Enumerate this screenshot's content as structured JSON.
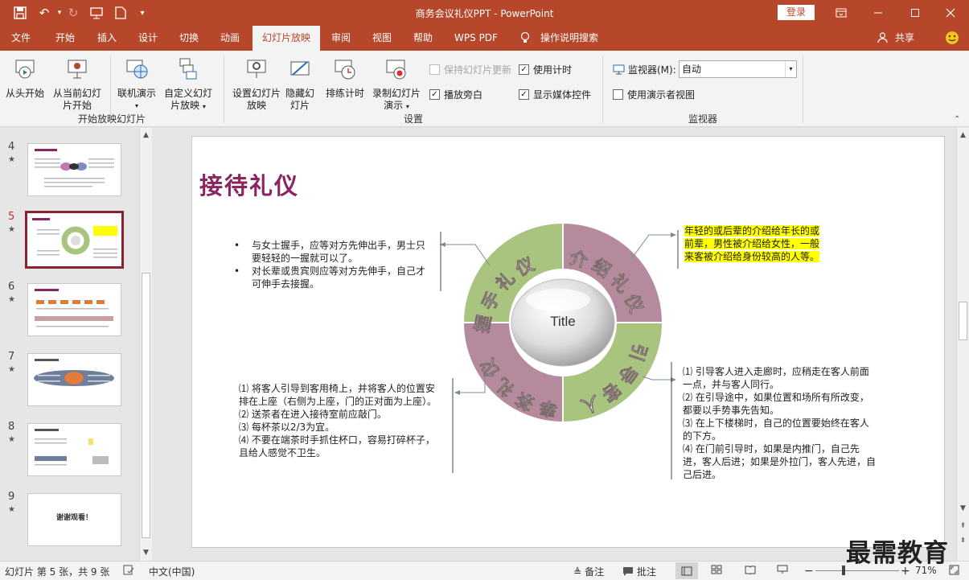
{
  "window": {
    "title": "商务会议礼仪PPT  -  PowerPoint",
    "login_label": "登录",
    "share_label": "共享"
  },
  "tabs": [
    "文件",
    "开始",
    "插入",
    "设计",
    "切换",
    "动画",
    "幻灯片放映",
    "审阅",
    "视图",
    "帮助",
    "WPS PDF",
    "操作说明搜索"
  ],
  "active_tab": "幻灯片放映",
  "ribbon": {
    "start_group": {
      "label": "开始放映幻灯片",
      "buttons": [
        "从头开始",
        "从当前幻灯片开始",
        "联机演示",
        "自定义幻灯片放映"
      ]
    },
    "setup_group": {
      "label": "设置",
      "buttons": [
        "设置幻灯片放映",
        "隐藏幻灯片",
        "排练计时",
        "录制幻灯片演示"
      ],
      "checks": [
        {
          "label": "保持幻灯片更新",
          "checked": false,
          "disabled": true
        },
        {
          "label": "使用计时",
          "checked": true,
          "disabled": false
        },
        {
          "label": "播放旁白",
          "checked": true,
          "disabled": false
        },
        {
          "label": "显示媒体控件",
          "checked": true,
          "disabled": false
        }
      ]
    },
    "monitor_group": {
      "label": "监视器",
      "monitor_label": "监视器(M):",
      "monitor_value": "自动",
      "presenter_view": {
        "label": "使用演示者视图",
        "checked": false
      }
    }
  },
  "thumbnails": [
    {
      "num": "4",
      "selected": false,
      "text": ""
    },
    {
      "num": "5",
      "selected": true,
      "text": ""
    },
    {
      "num": "6",
      "selected": false,
      "text": ""
    },
    {
      "num": "7",
      "selected": false,
      "text": ""
    },
    {
      "num": "8",
      "selected": false,
      "text": ""
    },
    {
      "num": "9",
      "selected": false,
      "text": "谢谢观看！"
    }
  ],
  "slide": {
    "title": "接待礼仪",
    "center_label": "Title",
    "segments": [
      "握手礼仪",
      "介绍礼仪",
      "引导客人",
      "奉茶礼仪"
    ],
    "handshake_bullets": [
      "与女士握手，应等对方先伸出手，男士只要轻轻的一握就可以了。",
      "对长辈或贵宾则应等对方先伸手，自己才可伸手去接握。"
    ],
    "intro_text": "年轻的或后辈的介绍给年长的或前辈，男性被介绍给女性，一般来客被介绍给身份较高的人等。",
    "guide_lines": [
      "⑴ 引导客人进入走廊时，应稍走在客人前面一点，并与客人同行。",
      "⑵ 在引导途中，如果位置和场所有所改变，都要以手势事先告知。",
      "⑶ 在上下楼梯时，自己的位置要始终在客人的下方。",
      "⑷ 在门前引导时，如果是内推门，自己先进，客人后进；如果是外拉门，客人先进，自己后进。"
    ],
    "tea_lines": [
      "⑴ 将客人引导到客用椅上，并将客人的位置安排在上座（右侧为上座，门的正对面为上座）。",
      "⑵ 送茶者在进入接待室前应敲门。",
      "⑶ 每杯茶以2/3为宜。",
      "⑷ 不要在端茶时手抓住杯口，容易打碎杯子，且给人感觉不卫生。"
    ]
  },
  "status": {
    "slide_info": "幻灯片 第 5 张，共 9 张",
    "language": "中文(中国)",
    "notes_label": "备注",
    "comments_label": "批注",
    "zoom": "71%",
    "zoom_fraction": 0.71
  },
  "watermark": "最需教育",
  "colors": {
    "accent": "#b7472a",
    "title_purple": "#8b2560",
    "ring_green": "#a8c47f",
    "ring_mauve": "#b58a9c",
    "highlight": "#ffff00"
  }
}
